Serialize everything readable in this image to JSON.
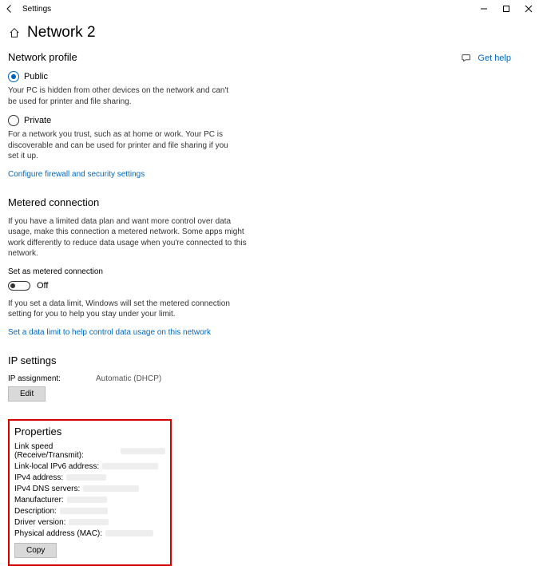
{
  "window": {
    "title": "Settings"
  },
  "header": {
    "page_title": "Network 2"
  },
  "side": {
    "help_label": "Get help"
  },
  "profile": {
    "heading": "Network profile",
    "public_label": "Public",
    "public_desc": "Your PC is hidden from other devices on the network and can't be used for printer and file sharing.",
    "private_label": "Private",
    "private_desc": "For a network you trust, such as at home or work. Your PC is discoverable and can be used for printer and file sharing if you set it up.",
    "firewall_link": "Configure firewall and security settings"
  },
  "metered": {
    "heading": "Metered connection",
    "desc": "If you have a limited data plan and want more control over data usage, make this connection a metered network. Some apps might work differently to reduce data usage when you're connected to this network.",
    "toggle_label": "Set as metered connection",
    "toggle_state": "Off",
    "limit_desc": "If you set a data limit, Windows will set the metered connection setting for you to help you stay under your limit.",
    "limit_link": "Set a data limit to help control data usage on this network"
  },
  "ip": {
    "heading": "IP settings",
    "assignment_label": "IP assignment:",
    "assignment_value": "Automatic (DHCP)",
    "edit_label": "Edit"
  },
  "properties": {
    "heading": "Properties",
    "rows": [
      "Link speed (Receive/Transmit):",
      "Link-local IPv6 address:",
      "IPv4 address:",
      "IPv4 DNS servers:",
      "Manufacturer:",
      "Description:",
      "Driver version:",
      "Physical address (MAC):"
    ],
    "copy_label": "Copy"
  }
}
